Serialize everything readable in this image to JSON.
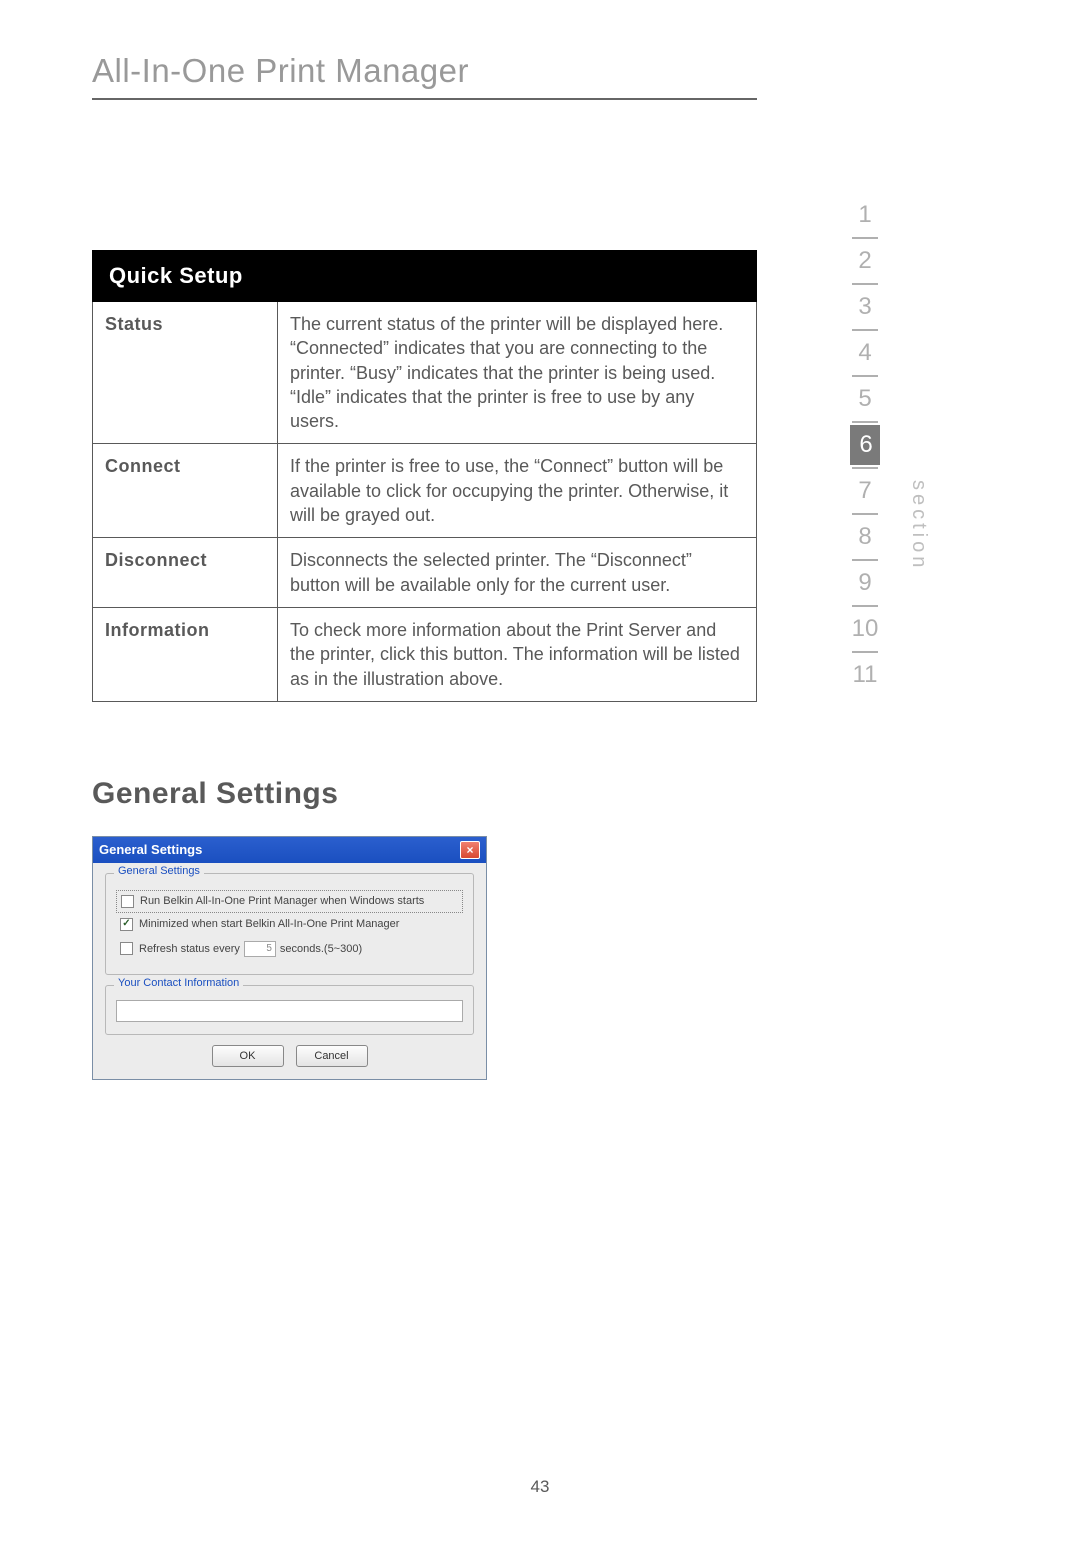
{
  "page_title": "All-In-One Print Manager",
  "table": {
    "header": "Quick Setup",
    "rows": [
      {
        "label": "Status",
        "desc": "The current status of the printer will be displayed here. “Connected” indicates that you are connecting to the printer. “Busy” indicates that the printer is being used. “Idle” indicates that the printer is free to use by any users."
      },
      {
        "label": "Connect",
        "desc": "If the printer is free to use, the “Connect” button will be available to click for occupying the printer. Otherwise, it will be grayed out."
      },
      {
        "label": "Disconnect",
        "desc": "Disconnects the selected printer. The “Disconnect” button will be available only for the current user."
      },
      {
        "label": "Information",
        "desc": "To check more information about the Print Server and the printer, click this button. The information will be listed as in the illustration above."
      }
    ]
  },
  "section_heading": "General Settings",
  "dialog": {
    "title": "General Settings",
    "group1_legend": "General Settings",
    "opt_run": "Run Belkin All-In-One Print Manager when Windows starts",
    "opt_min": "Minimized when start Belkin All-In-One Print Manager",
    "opt_refresh_pre": "Refresh status every",
    "opt_refresh_val": "5",
    "opt_refresh_post": "seconds.(5~300)",
    "group2_legend": "Your Contact Information",
    "ok": "OK",
    "cancel": "Cancel"
  },
  "nav": {
    "label": "section",
    "items": [
      "1",
      "2",
      "3",
      "4",
      "5",
      "6",
      "7",
      "8",
      "9",
      "10",
      "11"
    ],
    "active_index": 5
  },
  "page_number": "43"
}
